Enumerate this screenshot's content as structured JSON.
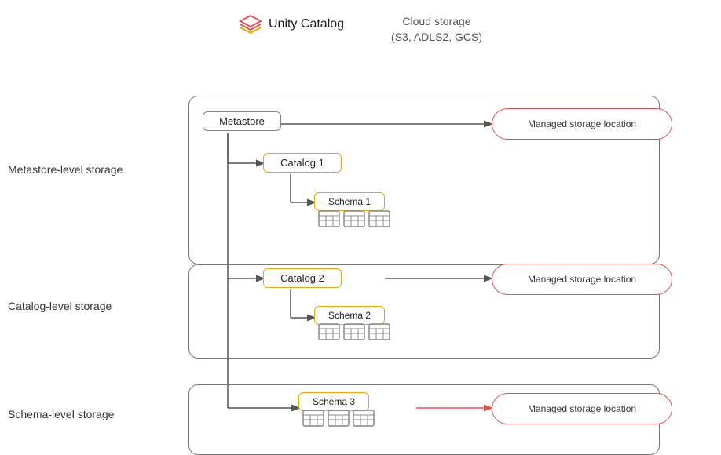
{
  "header": {
    "unity_catalog_label": "Unity Catalog",
    "cloud_storage_label": "Cloud storage",
    "cloud_storage_sub": "(S3, ADLS2, GCS)"
  },
  "sections": {
    "metastore_level": "Metastore-level storage",
    "catalog_level": "Catalog-level storage",
    "schema_level": "Schema-level storage"
  },
  "nodes": {
    "metastore": "Metastore",
    "catalog1": "Catalog 1",
    "catalog2": "Catalog 2",
    "schema1": "Schema 1",
    "schema2": "Schema 2",
    "schema3": "Schema 3"
  },
  "managed_location_label": "Managed storage location",
  "colors": {
    "border_default": "#888888",
    "border_catalog": "#e8a800",
    "border_managed": "#e05252",
    "border_container": "#aaaaaa",
    "arrow": "#555555",
    "arrow_managed": "#e05252"
  }
}
